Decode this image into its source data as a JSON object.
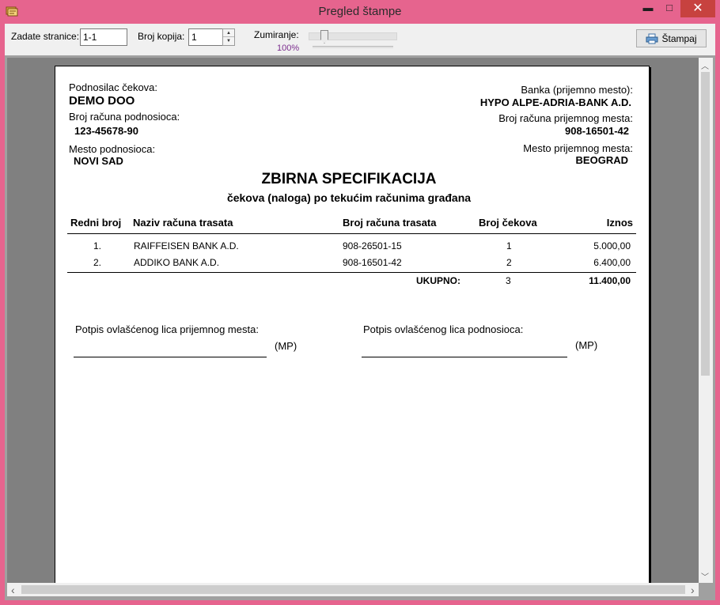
{
  "window": {
    "title": "Pregled štampe",
    "minimize_glyph": "▬",
    "maximize_glyph": "□",
    "close_glyph": "✕",
    "title_bar_color": "#e6648e",
    "close_button_color": "#c7423f"
  },
  "toolbar": {
    "pages_label": "Zadate stranice:",
    "pages_value": "1-1",
    "copies_label": "Broj kopija:",
    "copies_value": "1",
    "zoom_label": "Zumiranje:",
    "zoom_value": "100%",
    "zoom_level_percent": 100,
    "print_label": "Štampaj",
    "print_icon": "printer-icon"
  },
  "document": {
    "submitter_label": "Podnosilac čekova:",
    "submitter_name": "DEMO DOO",
    "submitter_account_label": "Broj računa podnosioca:",
    "submitter_account": "123-45678-90",
    "submitter_place_label": "Mesto podnosioca:",
    "submitter_place": "NOVI SAD",
    "bank_label": "Banka (prijemno mesto):",
    "bank_name": "HYPO ALPE-ADRIA-BANK A.D.",
    "bank_account_label": "Broj računa prijemnog mesta:",
    "bank_account": "908-16501-42",
    "bank_place_label": "Mesto prijemnog mesta:",
    "bank_place": "BEOGRAD",
    "title": "ZBIRNA SPECIFIKACIJA",
    "subtitle": "čekova (naloga) po tekućim računima građana",
    "columns": [
      "Redni broj",
      "Naziv računa trasata",
      "Broj računa trasata",
      "Broj čekova",
      "Iznos"
    ],
    "rows": [
      [
        "1.",
        "RAIFFEISEN BANK A.D.",
        "908-26501-15",
        "1",
        "5.000,00"
      ],
      [
        "2.",
        "ADDIKO BANK A.D.",
        "908-16501-42",
        "2",
        "6.400,00"
      ]
    ],
    "total_label": "UKUPNO:",
    "total_count": "3",
    "total_amount": "11.400,00",
    "signature_bank_label": "Potpis ovlašćenog lica prijemnog mesta:",
    "signature_submitter_label": "Potpis ovlašćenog lica podnosioca:",
    "stamp_mark": "(MP)"
  },
  "scrollbars": {
    "up_glyph": "︿",
    "down_glyph": "﹀",
    "left_glyph": "‹",
    "right_glyph": "›"
  }
}
